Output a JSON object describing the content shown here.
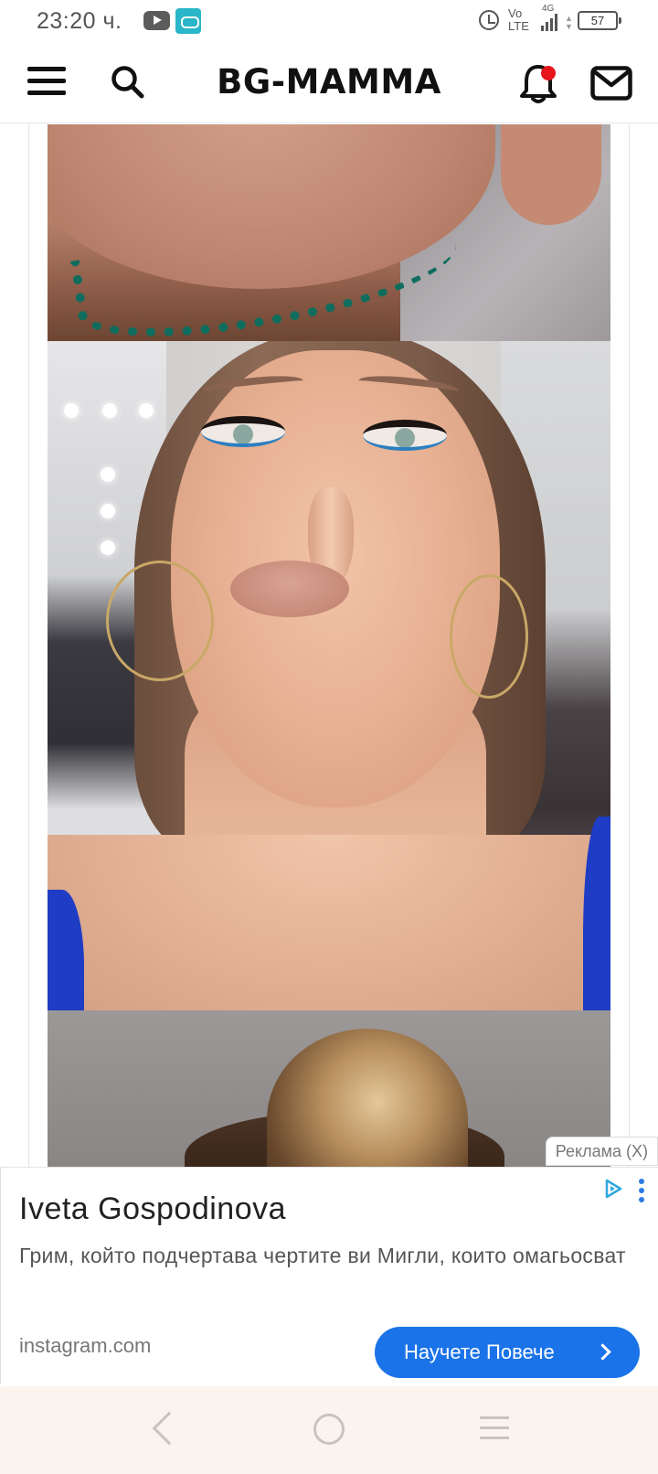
{
  "status_bar": {
    "time": "23:20 ч.",
    "network_top": "Vo",
    "network_bottom": "LTE",
    "network_gen": "4G",
    "battery": "57",
    "icons": [
      "youtube-icon",
      "game-icon",
      "alarm-icon",
      "signal-icon",
      "battery-icon"
    ]
  },
  "header": {
    "logo": "BG-MAMMA",
    "icons": [
      "menu-icon",
      "search-icon",
      "notification-bell-icon",
      "mail-icon"
    ],
    "notification_color": "#e8141c"
  },
  "ad": {
    "label": "Реклама (X)",
    "title": "Iveta Gospodinova",
    "description": "Грим, който подчертава чертите ви Мигли, които омагьосват",
    "domain": "instagram.com",
    "cta_label": "Научете Повече",
    "cta_color": "#1a73e8",
    "icons": [
      "adchoices-icon",
      "more-options-icon",
      "chevron-right-icon"
    ]
  },
  "navbar": {
    "icons": [
      "back-icon",
      "home-icon",
      "recents-icon"
    ]
  }
}
